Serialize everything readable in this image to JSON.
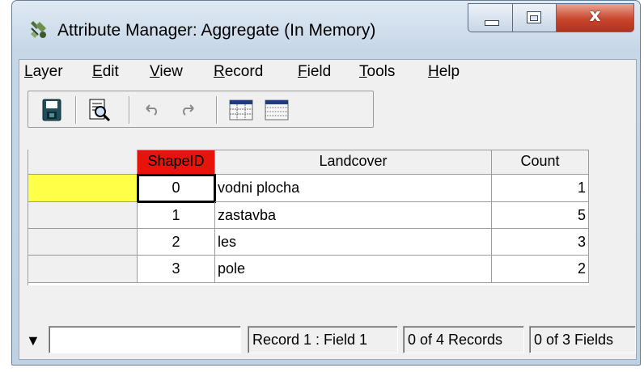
{
  "window": {
    "title": "Attribute Manager: Aggregate (In Memory)",
    "close_glyph": "x"
  },
  "menu": [
    "Layer",
    "Edit",
    "View",
    "Record",
    "Field",
    "Tools",
    "Help"
  ],
  "toolbar": {
    "buttons": [
      "save-icon",
      "preview-icon",
      "undo-icon",
      "redo-icon",
      "table-grid-icon",
      "table-dotted-icon"
    ]
  },
  "grid": {
    "columns": [
      "ShapeID",
      "Landcover",
      "Count"
    ],
    "selected_column": "ShapeID",
    "rows": [
      {
        "shapeid": "0",
        "landcover": "vodni plocha",
        "count": "1"
      },
      {
        "shapeid": "1",
        "landcover": "zastavba",
        "count": "5"
      },
      {
        "shapeid": "2",
        "landcover": "les",
        "count": "3"
      },
      {
        "shapeid": "3",
        "landcover": "pole",
        "count": "2"
      }
    ]
  },
  "status": {
    "arrow": "▼",
    "input_value": "",
    "position": "Record 1 : Field 1",
    "records": "0 of 4 Records",
    "fields": "0 of 3 Fields"
  },
  "colors": {
    "current_row_indicator": "#ffff47",
    "selected_header": "#e8140c",
    "close_button": "#c8462c"
  }
}
